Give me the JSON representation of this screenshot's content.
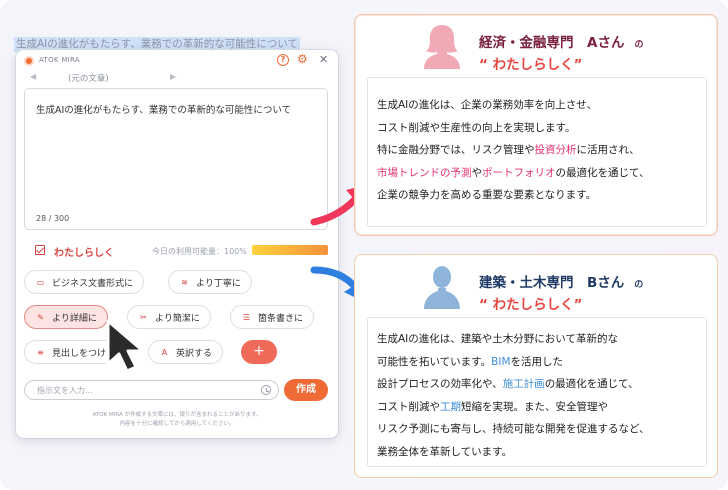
{
  "source_selection": "生成AIの進化がもたらす、業務での革新的な可能性について",
  "window": {
    "app_title": "ATOK MIRA",
    "nav_label": "(元の文章)",
    "input_text": "生成AIの進化がもたらす、業務での革新的な可能性について",
    "char_count": "28 / 300",
    "style_label": "わたしらしく",
    "usage_label": "今日の利用可能量：100%",
    "usage_level": 1.0,
    "buttons": {
      "business": "ビジネス文書形式に",
      "polite": "より丁寧に",
      "detailed": "より詳細に",
      "concise": "より簡潔に",
      "bullets": "箇条書きに",
      "heading": "見出しをつけ",
      "translate": "英訳する",
      "plus": "+"
    },
    "instruction_placeholder": "指示文を入力...",
    "create_label": "作成",
    "disclaimer_line1": "ATOK MIRA が作成する文章には、誤りが含まれることがあります。",
    "disclaimer_line2": "内容を十分に確認してから適用してください。"
  },
  "card_a": {
    "title": "経済・金融専門　Aさん",
    "no": "の",
    "style": "“ わたしらしく”",
    "line1": "生成AIの進化は、企業の業務効率を向上させ、",
    "line2": "コスト削減や生産性の向上を実現します。",
    "line3a": "特に金融分野では、リスク管理や",
    "line3b": "投資分析",
    "line3c": "に活用され、",
    "line4a": "市場トレンドの予測",
    "line4b": "や",
    "line4c": "ポートフォリオ",
    "line4d": "の最適化を通じて、",
    "line5": "企業の競争力を高める重要な要素となります。"
  },
  "card_b": {
    "title": "建築・土木専門　Bさん",
    "no": "の",
    "style": "“ わたしらしく”",
    "line1": "生成AIの進化は、建築や土木分野において革新的な",
    "line2a": "可能性を拓いています。",
    "line2b": "BIM",
    "line2c": "を活用した",
    "line3a": "設計プロセスの効率化や、",
    "line3b": "施工計画",
    "line3c": "の最適化を通じて、",
    "line4a": "コスト削減や",
    "line4b": "工期",
    "line4c": "短縮を実現。また、安全管理や",
    "line5": "リスク予測にも寄与し、持続可能な開発を促進するなど、",
    "line6": "業務全体を革新しています。"
  },
  "colors": {
    "accent": "#f06a35",
    "red_label": "#d9433f",
    "highlight_pink": "#e8326f",
    "highlight_blue": "#3d8ed8",
    "arrow_pink": "#f0365a",
    "arrow_blue": "#2f7fe0"
  },
  "icons": [
    "logo-icon",
    "help-icon",
    "gear-icon",
    "close-icon",
    "chevron-left-icon",
    "chevron-right-icon",
    "briefcase-icon",
    "hands-icon",
    "pen-icon",
    "scissors-icon",
    "list-icon",
    "heading-icon",
    "translate-icon",
    "history-icon",
    "cursor-icon",
    "person-icon",
    "arrow-icon"
  ]
}
